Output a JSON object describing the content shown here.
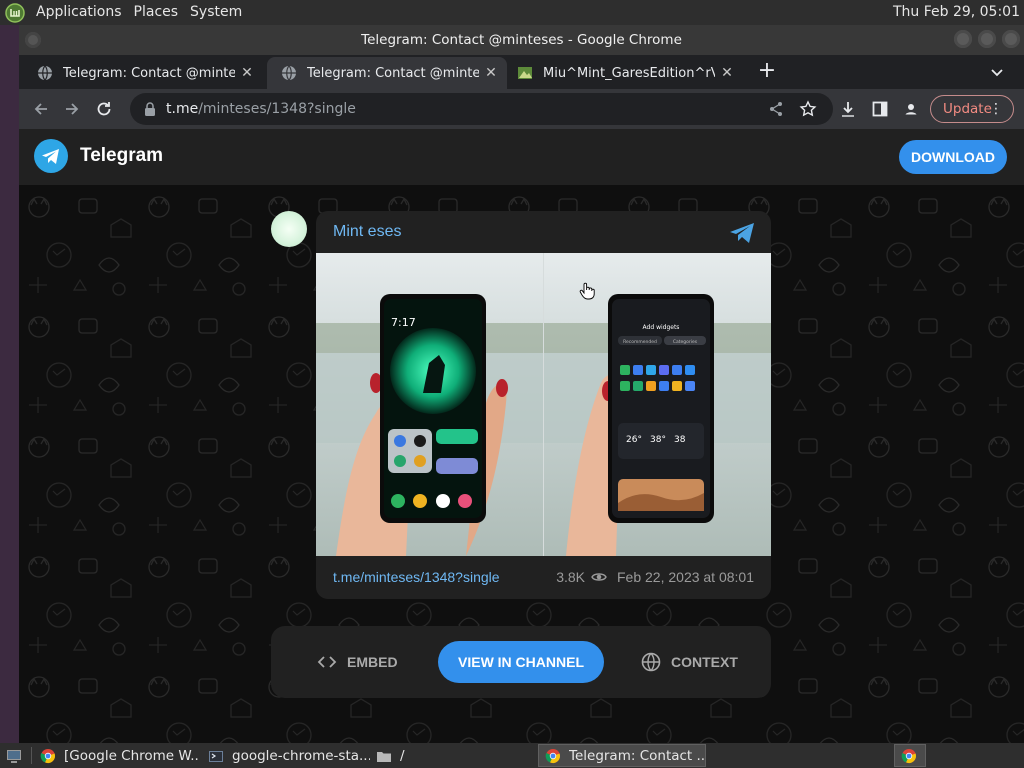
{
  "system": {
    "menus": [
      "Applications",
      "Places",
      "System"
    ],
    "clock": "Thu Feb 29, 05:01"
  },
  "window": {
    "title": "Telegram: Contact @minteses - Google Chrome"
  },
  "tabs": [
    {
      "label": "Telegram: Contact @minteses",
      "active": false
    },
    {
      "label": "Telegram: Contact @minteses",
      "active": true
    },
    {
      "label": "Miu^Mint_GaresEdition^rV.RAR",
      "active": false
    }
  ],
  "toolbar": {
    "url_host": "t.me",
    "url_path": "/minteses/1348?single",
    "update_label": "Update"
  },
  "telegram": {
    "brand": "Telegram",
    "download_label": "DOWNLOAD",
    "accent": "#3390ec"
  },
  "message": {
    "author": "Mint eses",
    "link": "t.me/minteses/1348?single",
    "views": "3.8K",
    "date": "Feb 22, 2023 at 08:01",
    "phone_left": {
      "time": "7:17"
    },
    "phone_right": {
      "heading": "Add widgets",
      "tabs": [
        "Recommended",
        "Categories"
      ],
      "temps": [
        "26°",
        "38°",
        "38"
      ]
    }
  },
  "actions": {
    "embed": "EMBED",
    "view": "VIEW IN CHANNEL",
    "context": "CONTEXT"
  },
  "taskbar": [
    {
      "label": "[Google Chrome W...",
      "icon": "chrome-icon"
    },
    {
      "label": "google-chrome-sta...",
      "icon": "terminal-icon"
    },
    {
      "label": "/",
      "icon": "folder-icon"
    },
    {
      "label": "Telegram: Contact ...",
      "icon": "chrome-icon",
      "active": true
    }
  ]
}
